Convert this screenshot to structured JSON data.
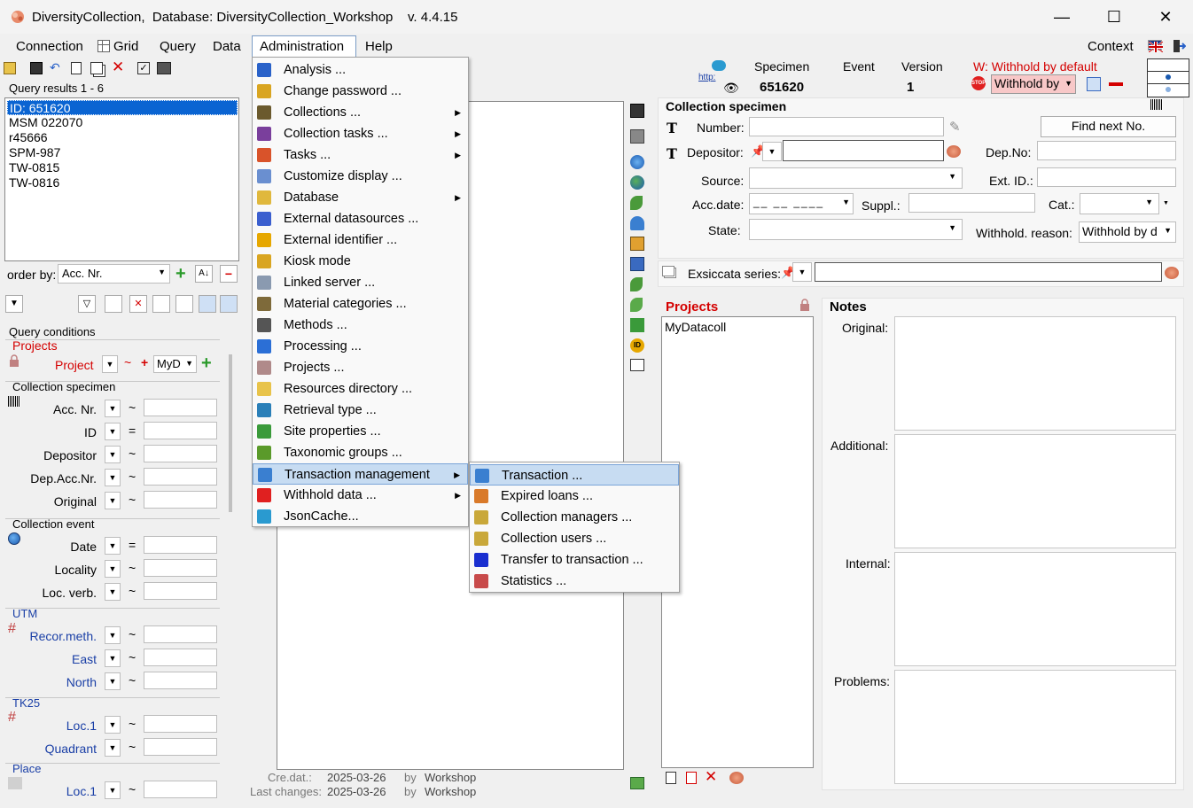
{
  "window": {
    "title": "DiversityCollection,  Database: DiversityCollection_Workshop    v. 4.4.15",
    "min": "—",
    "max": "☐",
    "close": "✕"
  },
  "menubar": {
    "items": [
      "Connection",
      "Grid",
      "Query",
      "Data",
      "Administration",
      "Help"
    ],
    "context": "Context"
  },
  "query_results": {
    "label": "Query results   1 - 6",
    "items": [
      "ID: 651620",
      "MSM 022070",
      "r45666",
      "SPM-987",
      "TW-0815",
      "TW-0816"
    ],
    "order_by_label": "order by:",
    "order_by_value": "Acc. Nr."
  },
  "query_conditions": {
    "title": "Query conditions",
    "projects_group": "Projects",
    "project_label": "Project",
    "project_value": "MyD",
    "collection_specimen_group": "Collection specimen",
    "cs_fields": [
      {
        "label": "Acc. Nr.",
        "op": "~"
      },
      {
        "label": "ID",
        "op": "="
      },
      {
        "label": "Depositor",
        "op": "~"
      },
      {
        "label": "Dep.Acc.Nr.",
        "op": "~"
      },
      {
        "label": "Original",
        "op": "~"
      }
    ],
    "collection_event_group": "Collection event",
    "ce_fields": [
      {
        "label": "Date",
        "op": "="
      },
      {
        "label": "Locality",
        "op": "~"
      },
      {
        "label": "Loc. verb.",
        "op": "~"
      }
    ],
    "utm_group": "UTM",
    "utm_fields": [
      {
        "label": "Recor.meth.",
        "op": "~"
      },
      {
        "label": "East",
        "op": "~"
      },
      {
        "label": "North",
        "op": "~"
      }
    ],
    "tk25_group": "TK25",
    "tk25_fields": [
      {
        "label": "Loc.1",
        "op": "~"
      },
      {
        "label": "Quadrant",
        "op": "~"
      }
    ],
    "place_group": "Place",
    "place_fields": [
      {
        "label": "Loc.1",
        "op": "~"
      }
    ]
  },
  "admin_menu": {
    "items": [
      {
        "label": "Analysis ...",
        "sub": false,
        "icon": "analysis-icon",
        "color": "#2a62c9"
      },
      {
        "label": "Change password ...",
        "sub": false,
        "icon": "key-icon",
        "color": "#d9a521"
      },
      {
        "label": "Collections ...",
        "sub": true,
        "icon": "collections-icon",
        "color": "#6b5a2e"
      },
      {
        "label": "Collection tasks ...",
        "sub": true,
        "icon": "collection-tasks-icon",
        "color": "#7a3f9c"
      },
      {
        "label": "Tasks ...",
        "sub": true,
        "icon": "tasks-icon",
        "color": "#d9532a"
      },
      {
        "label": "Customize display ...",
        "sub": false,
        "icon": "display-icon",
        "color": "#6a8fd0"
      },
      {
        "label": "Database",
        "sub": true,
        "icon": "database-icon",
        "color": "#e0b83d"
      },
      {
        "label": "External datasources ...",
        "sub": false,
        "icon": "external-datasource-icon",
        "color": "#3b5fcf"
      },
      {
        "label": "External identifier ...",
        "sub": false,
        "icon": "id-icon",
        "color": "#e6a700"
      },
      {
        "label": "Kiosk mode",
        "sub": false,
        "icon": "kiosk-key-icon",
        "color": "#d9a521"
      },
      {
        "label": "Linked server ...",
        "sub": false,
        "icon": "linked-server-icon",
        "color": "#8a9ab0"
      },
      {
        "label": "Material categories ...",
        "sub": false,
        "icon": "material-icon",
        "color": "#7e6a3a"
      },
      {
        "label": "Methods ...",
        "sub": false,
        "icon": "methods-icon",
        "color": "#555555"
      },
      {
        "label": "Processing ...",
        "sub": false,
        "icon": "processing-icon",
        "color": "#2b6fd6"
      },
      {
        "label": "Projects ...",
        "sub": false,
        "icon": "lock-icon",
        "color": "#b08a8a"
      },
      {
        "label": "Resources directory ...",
        "sub": false,
        "icon": "folder-icon",
        "color": "#e8c34a"
      },
      {
        "label": "Retrieval type ...",
        "sub": false,
        "icon": "retrieval-icon",
        "color": "#2a7fb8"
      },
      {
        "label": "Site properties ...",
        "sub": false,
        "icon": "site-icon",
        "color": "#3a9a3a"
      },
      {
        "label": "Taxonomic groups ...",
        "sub": false,
        "icon": "leaf-icon",
        "color": "#5a9a2a"
      },
      {
        "label": "Transaction management",
        "sub": true,
        "icon": "transaction-icon",
        "color": "#3a7fd0"
      },
      {
        "label": "Withhold data ...",
        "sub": true,
        "icon": "stop-icon",
        "color": "#e02020"
      },
      {
        "label": "JsonCache...",
        "sub": false,
        "icon": "cloud-icon",
        "color": "#2a9ad0"
      }
    ]
  },
  "transaction_submenu": {
    "items": [
      {
        "label": "Transaction ...",
        "icon": "transaction-icon",
        "color": "#3a7fd0"
      },
      {
        "label": "Expired loans ...",
        "icon": "expired-loans-icon",
        "color": "#d97a2a"
      },
      {
        "label": "Collection managers ...",
        "icon": "collection-managers-icon",
        "color": "#c9a83a"
      },
      {
        "label": "Collection users ...",
        "icon": "collection-users-icon",
        "color": "#c9a83a"
      },
      {
        "label": "Transfer to transaction ...",
        "icon": "arrow-right-icon",
        "color": "#1a2fd0"
      },
      {
        "label": "Statistics ...",
        "icon": "statistics-icon",
        "color": "#c84a4a"
      }
    ]
  },
  "header": {
    "http": "http:",
    "specimen_label": "Specimen",
    "specimen_value": "651620",
    "event_label": "Event",
    "version_label": "Version",
    "version_value": "1",
    "withhold_warning": "W: Withhold by default",
    "withhold_value": "Withhold by"
  },
  "collection_specimen": {
    "title": "Collection specimen",
    "number_label": "Number:",
    "find_next": "Find next No.",
    "depositor_label": "Depositor:",
    "dep_no_label": "Dep.No:",
    "source_label": "Source:",
    "ext_id_label": "Ext. ID.:",
    "acc_date_label": "Acc.date:",
    "suppl_label": "Suppl.:",
    "cat_label": "Cat.:",
    "state_label": "State:",
    "withhold_reason_label": "Withhold. reason:",
    "withhold_reason_value": "Withhold by d",
    "exsiccata_label": "Exsiccata series:"
  },
  "projects_panel": {
    "title": "Projects",
    "items": [
      "MyDatacoll"
    ]
  },
  "notes": {
    "title": "Notes",
    "original": "Original:",
    "additional": "Additional:",
    "internal": "Internal:",
    "problems": "Problems:"
  },
  "footer": {
    "cre_label": "Cre.dat.:",
    "cre_date": "2025-03-26",
    "by1": "by",
    "cre_user": "Workshop",
    "last_label": "Last changes:",
    "last_date": "2025-03-26",
    "by2": "by",
    "last_user": "Workshop"
  }
}
